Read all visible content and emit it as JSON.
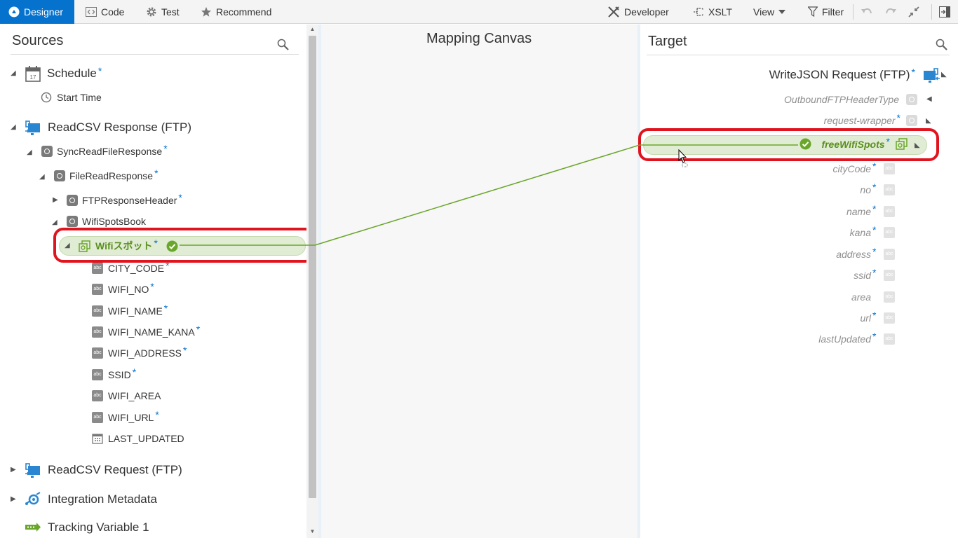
{
  "toolbar": {
    "designer": "Designer",
    "code": "Code",
    "test": "Test",
    "recommend": "Recommend",
    "developer": "Developer",
    "xslt": "XSLT",
    "view": "View",
    "filter": "Filter"
  },
  "sources": {
    "title": "Sources",
    "schedule": {
      "label": "Schedule",
      "required": "*",
      "calendar_day": "17",
      "start_time": "Start Time"
    },
    "readcsv_response": {
      "label": "ReadCSV Response (FTP)"
    },
    "sync_read": {
      "label": "SyncReadFileResponse",
      "required": "*"
    },
    "file_read": {
      "label": "FileReadResponse",
      "required": "*"
    },
    "ftp_header": {
      "label": "FTPResponseHeader",
      "required": "*"
    },
    "wifi_book": {
      "label": "WifiSpotsBook"
    },
    "wifi_spot": {
      "label": "Wifiスポット",
      "required": "*"
    },
    "fields": [
      {
        "label": "CITY_CODE",
        "required": "*",
        "type": "abc"
      },
      {
        "label": "WIFI_NO",
        "required": "*",
        "type": "abc"
      },
      {
        "label": "WIFI_NAME",
        "required": "*",
        "type": "abc"
      },
      {
        "label": "WIFI_NAME_KANA",
        "required": "*",
        "type": "abc"
      },
      {
        "label": "WIFI_ADDRESS",
        "required": "*",
        "type": "abc"
      },
      {
        "label": "SSID",
        "required": "*",
        "type": "abc"
      },
      {
        "label": "WIFI_AREA",
        "required": "",
        "type": "abc"
      },
      {
        "label": "WIFI_URL",
        "required": "*",
        "type": "abc"
      },
      {
        "label": "LAST_UPDATED",
        "required": "",
        "type": "date"
      }
    ],
    "readcsv_request": {
      "label": "ReadCSV Request (FTP)"
    },
    "integration_metadata": {
      "label": "Integration Metadata"
    },
    "tracking_variable": {
      "label": "Tracking Variable 1"
    }
  },
  "canvas": {
    "title": "Mapping Canvas"
  },
  "target": {
    "title": "Target",
    "root": {
      "label": "WriteJSON Request (FTP)",
      "required": "*"
    },
    "outbound_header": {
      "label": "OutboundFTPHeaderType"
    },
    "request_wrapper": {
      "label": "request-wrapper",
      "required": "*"
    },
    "free_wifi": {
      "label": "freeWifiSpots",
      "required": "*"
    },
    "fields": [
      {
        "label": "cityCode",
        "required": "*"
      },
      {
        "label": "no",
        "required": "*"
      },
      {
        "label": "name",
        "required": "*"
      },
      {
        "label": "kana",
        "required": "*"
      },
      {
        "label": "address",
        "required": "*"
      },
      {
        "label": "ssid",
        "required": "*"
      },
      {
        "label": "area",
        "required": ""
      },
      {
        "label": "url",
        "required": "*"
      },
      {
        "label": "lastUpdated",
        "required": "*"
      }
    ]
  },
  "field_type_text": "abc",
  "colors": {
    "accent": "#0572ce",
    "mapped_green": "#6aa62a",
    "highlight_red": "#e0141e"
  }
}
